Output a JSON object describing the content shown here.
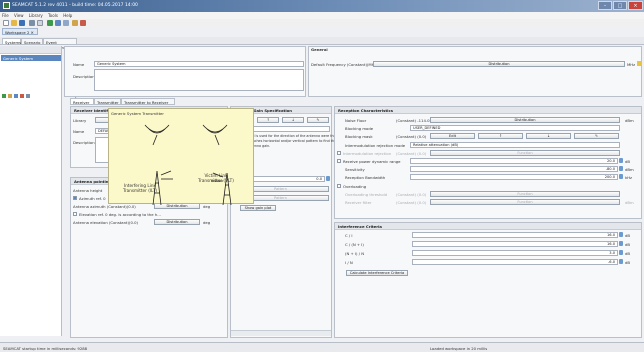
{
  "window": {
    "title": "SEAMCAT 5.1.2 rev 4011 - build time: 04.05.2017 14:00",
    "min": "–",
    "max": "□",
    "close": "×"
  },
  "menu": [
    "File",
    "View",
    "Library",
    "Tools",
    "Help"
  ],
  "workspace_tab": "Workspace 2 ✕",
  "sub_tabs": [
    "Systems",
    "Scenario",
    "Event Processing"
  ],
  "system_list": {
    "header": "System",
    "items": [
      "Generic System"
    ]
  },
  "system": {
    "header": "System",
    "name_label": "Name",
    "name_value": "Generic System",
    "description_label": "Description"
  },
  "general": {
    "header": "General",
    "default_freq_label": "Default Frequency (Constant)(MHz)",
    "default_freq_dist": "Distribution",
    "default_freq_unit": "MHz"
  },
  "section_tabs": [
    "Receiver",
    "Transmitter",
    "Transmitter to Receiver Path"
  ],
  "receiver_ident": {
    "header": "Receiver Identification",
    "library_label": "Library",
    "name_label": "Name",
    "name_value": "DEFAU",
    "description_label": "Description"
  },
  "antenna_pointing": {
    "header": "Antenna pointing",
    "height_label": "Antenna height",
    "azimuth_label": "Azimuth ref. 0"
  },
  "antenna_rows": [
    {
      "label": "Antenna azimuth (Constant)(0.0)",
      "btn": "Distribution",
      "unit": "deg"
    },
    {
      "label": "Elevation ref. 0 deg. is according to the h..."
    },
    {
      "label": "Antenna elevation (Constant)(0.0)",
      "btn": "Distribution",
      "unit": "deg"
    }
  ],
  "antenna_gain": {
    "header": "Antenna Gain Specification",
    "buttons": [
      "Edit",
      "↑",
      "↓",
      "✎"
    ],
    "default_value": "DEFAULT",
    "note_lines": [
      "Field entered is used for the direction of the antenna were the",
      "elevation reaches horizontal and/or vertical pattern to find the",
      "receiver antenna gain."
    ],
    "value": "0.0",
    "pattern_btns": [
      "Pattern",
      "Pattern"
    ],
    "plot_btn": "Show gain plot"
  },
  "tooltip": {
    "title": "Generic System Transmitter",
    "left_label": "Interfering Link Transmitter (ILT)",
    "right_label": "Victim Link Transmitter (VLT)"
  },
  "reception": {
    "header": "Reception Characteristics",
    "rows": [
      {
        "label": "Noise Floor",
        "mid": "(Constant) -114.05",
        "btn": "Distribution",
        "unit": "dBm"
      },
      {
        "label": "Blocking mode",
        "value": "USER_DEFINED"
      },
      {
        "label": "Blocking mask",
        "mid": "(Constant) (0.0)",
        "btns": [
          "Edit",
          "↑",
          "↓",
          "✎"
        ]
      },
      {
        "label": "Intermodulation rejection mode",
        "value": "Relative attenuation (dB)"
      },
      {
        "label": "Intermodulation rejection",
        "mid": "(Constant) (0.0)",
        "btn": "Function"
      },
      {
        "label": "Receive power dynamic range",
        "num": "20.0",
        "unit": "dB"
      },
      {
        "label": "Sensitivity",
        "num": "-80.0",
        "unit": "dBm"
      },
      {
        "label": "Reception Bandwidth",
        "num": "200.0",
        "unit": "kHz"
      },
      {
        "label": "Overloading"
      },
      {
        "label": "Overloading threshold",
        "mid": "(Constant) (0.0)",
        "btn": "Function"
      },
      {
        "label": "Receiver filter",
        "mid": "(Constant) (0.0)",
        "btn": "Function",
        "unit": "dBm"
      }
    ]
  },
  "interference": {
    "header": "Interference Criteria",
    "rows": [
      {
        "label": "C / I",
        "num": "16.0",
        "unit": "dB"
      },
      {
        "label": "C / (N + I)",
        "num": "16.0",
        "unit": "dB"
      },
      {
        "label": "(N + I) / N",
        "num": "3.0",
        "unit": "dB"
      },
      {
        "label": "I / N",
        "num": "-6.0",
        "unit": "dB"
      }
    ],
    "calc_btn": "Calculate Interference Criteria"
  },
  "status": {
    "left": "SEAMCAT startup time in milliseconds: 9288",
    "right": "Loaded workspace in 20 millis"
  }
}
